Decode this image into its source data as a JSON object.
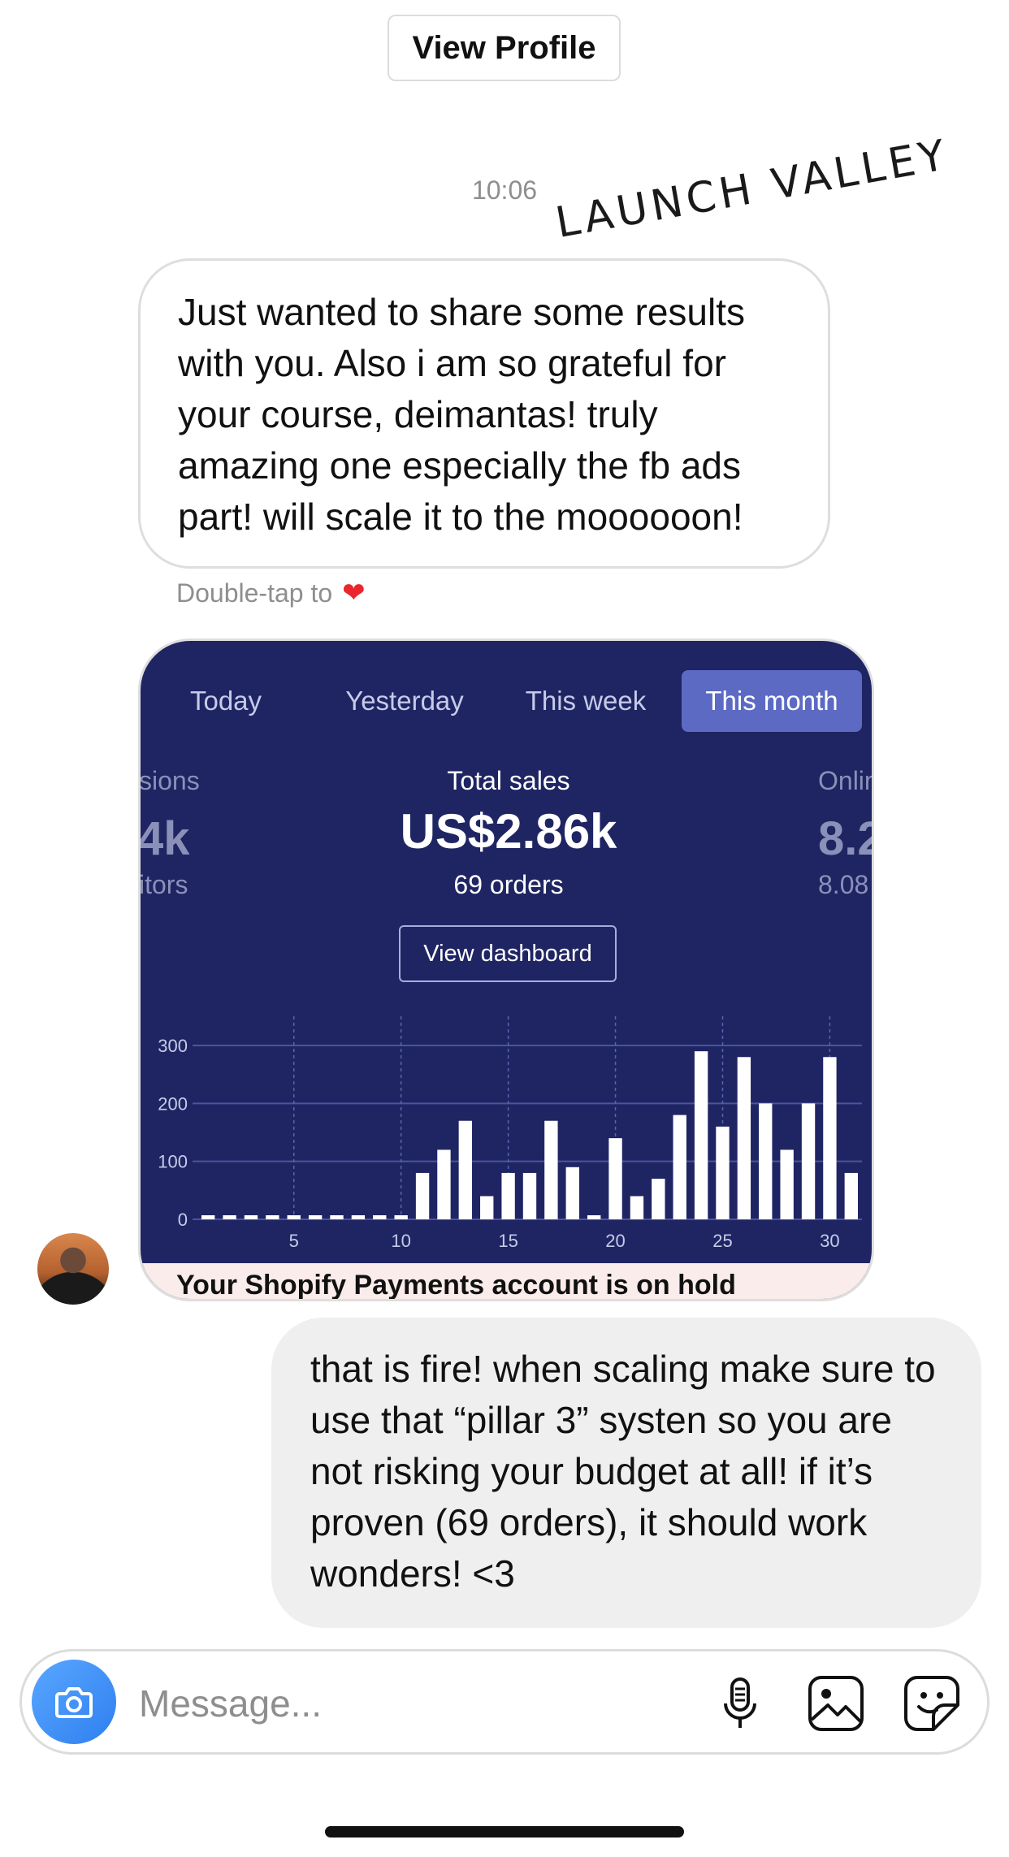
{
  "header": {
    "view_profile_label": "View Profile"
  },
  "timestamp": "10:06",
  "watermark": "LAUNCH VALLEY",
  "incoming_message": "Just wanted to share some results with you. Also i am so grateful for your course, deimantas! truly amazing one especially the fb ads part! will scale it to the moooooon!",
  "double_tap": {
    "label": "Double-tap to",
    "icon": "heart-emoji"
  },
  "shared_card": {
    "tabs": [
      {
        "label": "Today",
        "active": false
      },
      {
        "label": "Yesterday",
        "active": false
      },
      {
        "label": "This week",
        "active": false
      },
      {
        "label": "This month",
        "active": true
      }
    ],
    "left_metric": {
      "label": "sions",
      "value": "4k",
      "sub": "itors"
    },
    "center_metric": {
      "label": "Total sales",
      "value": "US$2.86k",
      "sub": "69 orders"
    },
    "right_metric": {
      "label": "Onlin",
      "value": "8.2",
      "sub": "8.08"
    },
    "view_dashboard_label": "View dashboard",
    "footer_text": "Your Shopify Payments account is on hold",
    "accent_color": "#5c6ac4",
    "background_color": "#1f2563"
  },
  "chart_data": {
    "type": "bar",
    "x": [
      1,
      2,
      3,
      4,
      5,
      6,
      7,
      8,
      9,
      10,
      11,
      12,
      13,
      14,
      15,
      16,
      17,
      18,
      19,
      20,
      21,
      22,
      23,
      24,
      25,
      26,
      27,
      28,
      29,
      30,
      31
    ],
    "values": [
      0,
      0,
      0,
      0,
      0,
      0,
      0,
      0,
      0,
      0,
      80,
      120,
      170,
      40,
      80,
      80,
      170,
      90,
      0,
      140,
      40,
      70,
      180,
      290,
      160,
      280,
      200,
      120,
      200,
      280,
      80
    ],
    "yticks": [
      0,
      100,
      200,
      300
    ],
    "xticks": [
      5,
      10,
      15,
      20,
      25,
      30
    ],
    "ylim": [
      0,
      300
    ],
    "grid": true,
    "title": "",
    "xlabel": "",
    "ylabel": ""
  },
  "outgoing_message": "that is fire! when scaling make sure to use that “pillar 3” systen so you are not risking your budget at all! if it’s proven (69 orders), it should work wonders! <3",
  "composer": {
    "placeholder": "Message...",
    "icons": [
      "camera-icon",
      "microphone-icon",
      "gallery-icon",
      "sticker-icon"
    ],
    "camera_color": "#3b8ef5"
  }
}
